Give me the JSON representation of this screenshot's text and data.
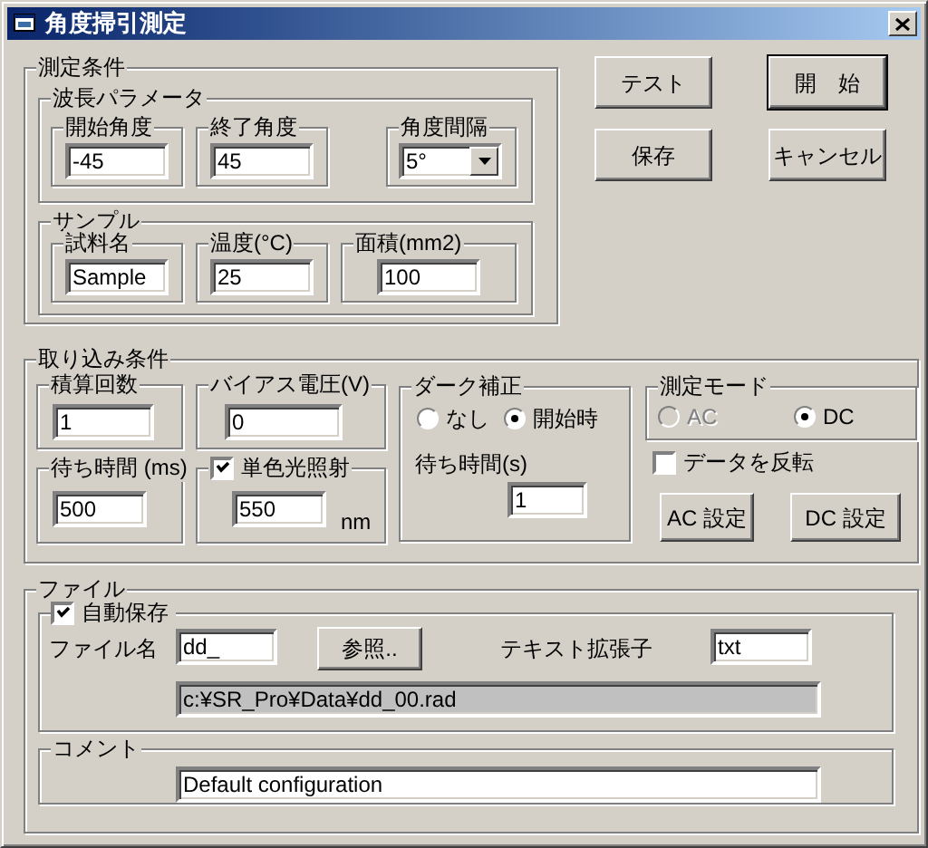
{
  "window": {
    "title": "角度掃引測定"
  },
  "measurement_conditions": {
    "label": "測定条件",
    "wavelength_parameters": {
      "label": "波長パラメータ",
      "start_angle": {
        "label": "開始角度",
        "value": "-45"
      },
      "end_angle": {
        "label": "終了角度",
        "value": "45"
      },
      "angle_interval": {
        "label": "角度間隔",
        "value": "5°"
      }
    },
    "sample": {
      "label": "サンプル",
      "sample_name": {
        "label": "試料名",
        "value": "Sample"
      },
      "temperature": {
        "label": "温度(°C)",
        "value": "25"
      },
      "area": {
        "label": "面積(mm2)",
        "value": "100"
      }
    }
  },
  "buttons": [
    {
      "label": "テスト",
      "default": false
    },
    {
      "label": "開　始",
      "default": true
    },
    {
      "label": "保存",
      "default": false
    },
    {
      "label": "キャンセル",
      "default": false
    }
  ],
  "acquisition_conditions": {
    "label": "取り込み条件",
    "integration_count": {
      "label": "積算回数",
      "value": "1"
    },
    "bias_voltage": {
      "label": "バイアス電圧(V)",
      "value": "0"
    },
    "wait_time": {
      "label": "待ち時間 (ms)",
      "value": "500"
    },
    "monochromatic": {
      "label": "単色光照射",
      "checked": true,
      "value": "550",
      "unit": "nm"
    },
    "dark_correction": {
      "label": "ダーク補正",
      "options": [
        {
          "label": "なし",
          "selected": false
        },
        {
          "label": "開始時",
          "selected": true
        }
      ],
      "wait_time": {
        "label": "待ち時間(s)",
        "value": "1"
      }
    },
    "measurement_mode": {
      "label": "測定モード",
      "options": [
        {
          "label": "AC",
          "selected": false,
          "disabled": true
        },
        {
          "label": "DC",
          "selected": true,
          "disabled": false
        }
      ]
    },
    "invert_data": {
      "label": "データを反転",
      "checked": false
    },
    "settings_buttons": [
      "AC 設定",
      "DC 設定"
    ]
  },
  "file": {
    "label": "ファイル",
    "auto_save": {
      "label": "自動保存",
      "checked": true,
      "file_name": {
        "label": "ファイル名",
        "value": "dd_"
      },
      "browse_button": "参照..",
      "text_extension": {
        "label": "テキスト拡張子",
        "value": "txt"
      },
      "path": "c:¥SR_Pro¥Data¥dd_00.rad"
    },
    "comment": {
      "label": "コメント",
      "value": "Default configuration"
    }
  }
}
